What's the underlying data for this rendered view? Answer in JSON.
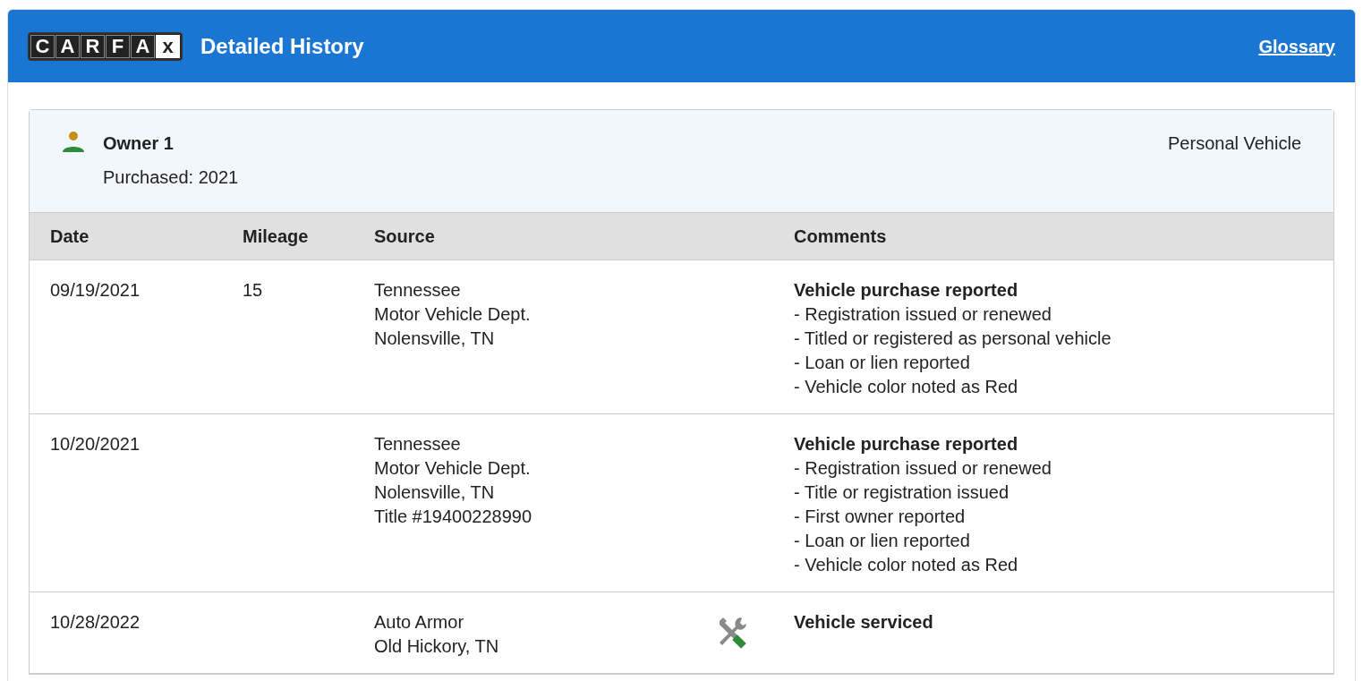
{
  "header": {
    "logo_letters": [
      "C",
      "A",
      "R",
      "F",
      "A",
      "x"
    ],
    "title": "Detailed History",
    "link": "Glossary"
  },
  "owner": {
    "name": "Owner 1",
    "purchased": "Purchased: 2021",
    "usage": "Personal Vehicle"
  },
  "table": {
    "columns": [
      "Date",
      "Mileage",
      "Source",
      "Comments"
    ],
    "rows": [
      {
        "date": "09/19/2021",
        "mileage": "15",
        "source": [
          "Tennessee",
          "Motor Vehicle Dept.",
          "Nolensville, TN"
        ],
        "kind": "record",
        "comment_title": "Vehicle purchase reported",
        "comments": [
          "- Registration issued or renewed",
          "- Titled or registered as personal vehicle",
          "- Loan or lien reported",
          "- Vehicle color noted as Red"
        ]
      },
      {
        "date": "10/20/2021",
        "mileage": "",
        "source": [
          "Tennessee",
          "Motor Vehicle Dept.",
          "Nolensville, TN",
          "Title #19400228990"
        ],
        "kind": "record",
        "comment_title": "Vehicle purchase reported",
        "comments": [
          "- Registration issued or renewed",
          "- Title or registration issued",
          "- First owner reported",
          "- Loan or lien reported",
          "- Vehicle color noted as Red"
        ]
      },
      {
        "date": "10/28/2022",
        "mileage": "",
        "source": [
          "Auto Armor",
          "Old Hickory, TN"
        ],
        "kind": "service",
        "comment_title": "Vehicle serviced",
        "comments": []
      }
    ]
  }
}
